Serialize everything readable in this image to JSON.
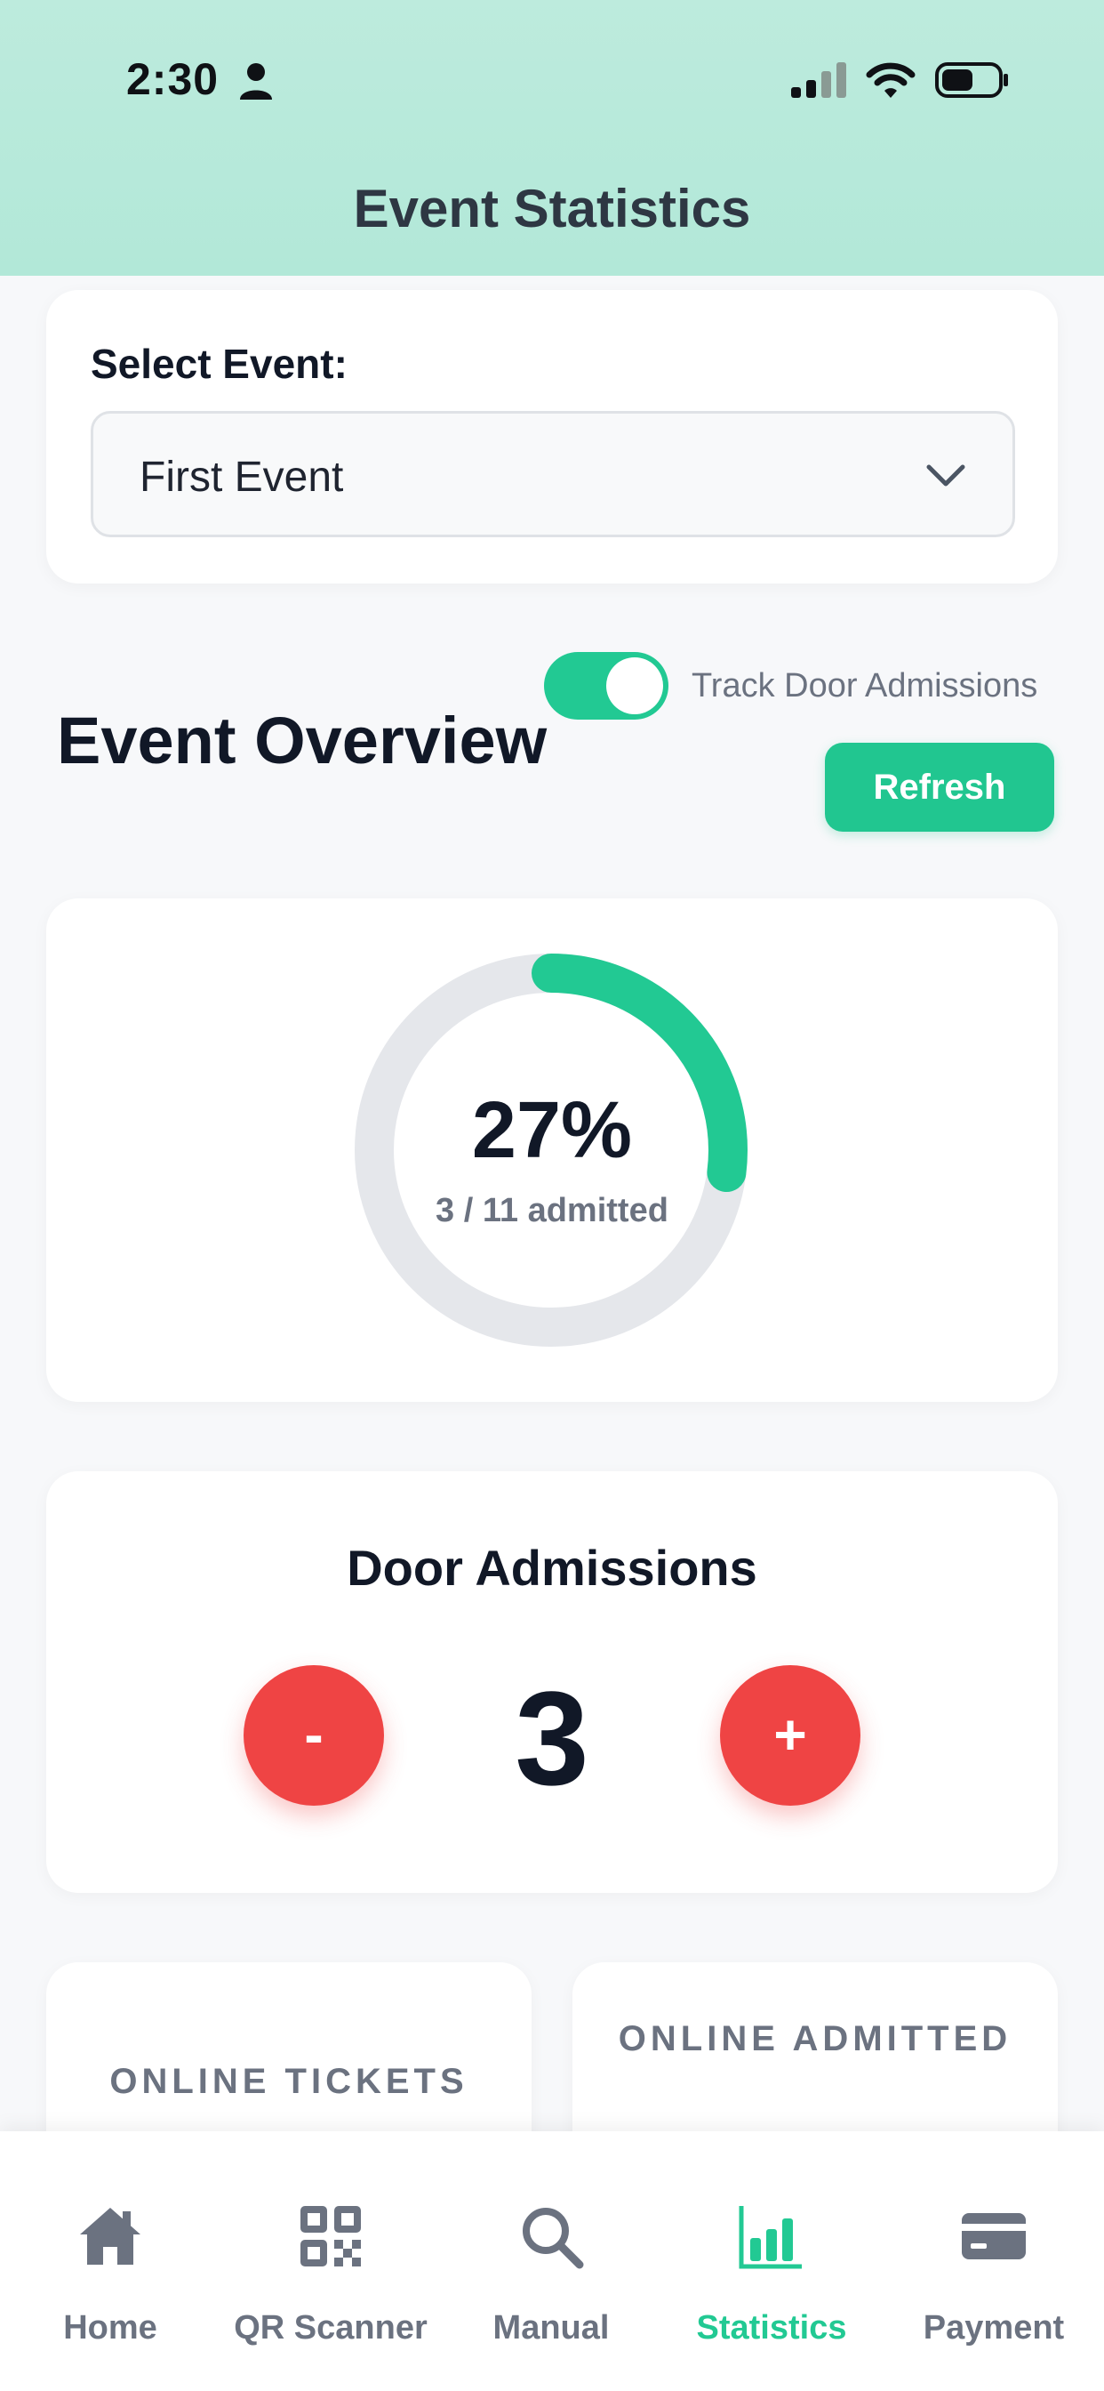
{
  "status_bar": {
    "time": "2:30"
  },
  "header": {
    "title": "Event Statistics"
  },
  "event_select": {
    "label": "Select Event:",
    "value": "First Event"
  },
  "overview": {
    "title": "Event Overview",
    "toggle_label": "Track Door Admissions",
    "toggle_on": true,
    "refresh_label": "Refresh",
    "progress_fraction": 0.27,
    "percent_text": "27%",
    "admitted_text": "3 / 11 admitted"
  },
  "door_admissions": {
    "title": "Door Admissions",
    "count": "3",
    "minus_label": "-",
    "plus_label": "+"
  },
  "stats": [
    {
      "label": "ONLINE TICKETS"
    },
    {
      "label": "ONLINE ADMITTED"
    }
  ],
  "tabs": [
    {
      "label": "Home",
      "icon": "home-icon",
      "active": false
    },
    {
      "label": "QR Scanner",
      "icon": "qr-code-icon",
      "active": false
    },
    {
      "label": "Manual",
      "icon": "search-icon",
      "active": false
    },
    {
      "label": "Statistics",
      "icon": "bar-chart-icon",
      "active": true
    },
    {
      "label": "Payment",
      "icon": "credit-card-icon",
      "active": false
    }
  ],
  "colors": {
    "accent": "#22c993",
    "danger": "#ef4444",
    "header_bg": "#b8eadb",
    "ring_track": "#e5e7eb",
    "inactive_tab": "#6b7280"
  }
}
